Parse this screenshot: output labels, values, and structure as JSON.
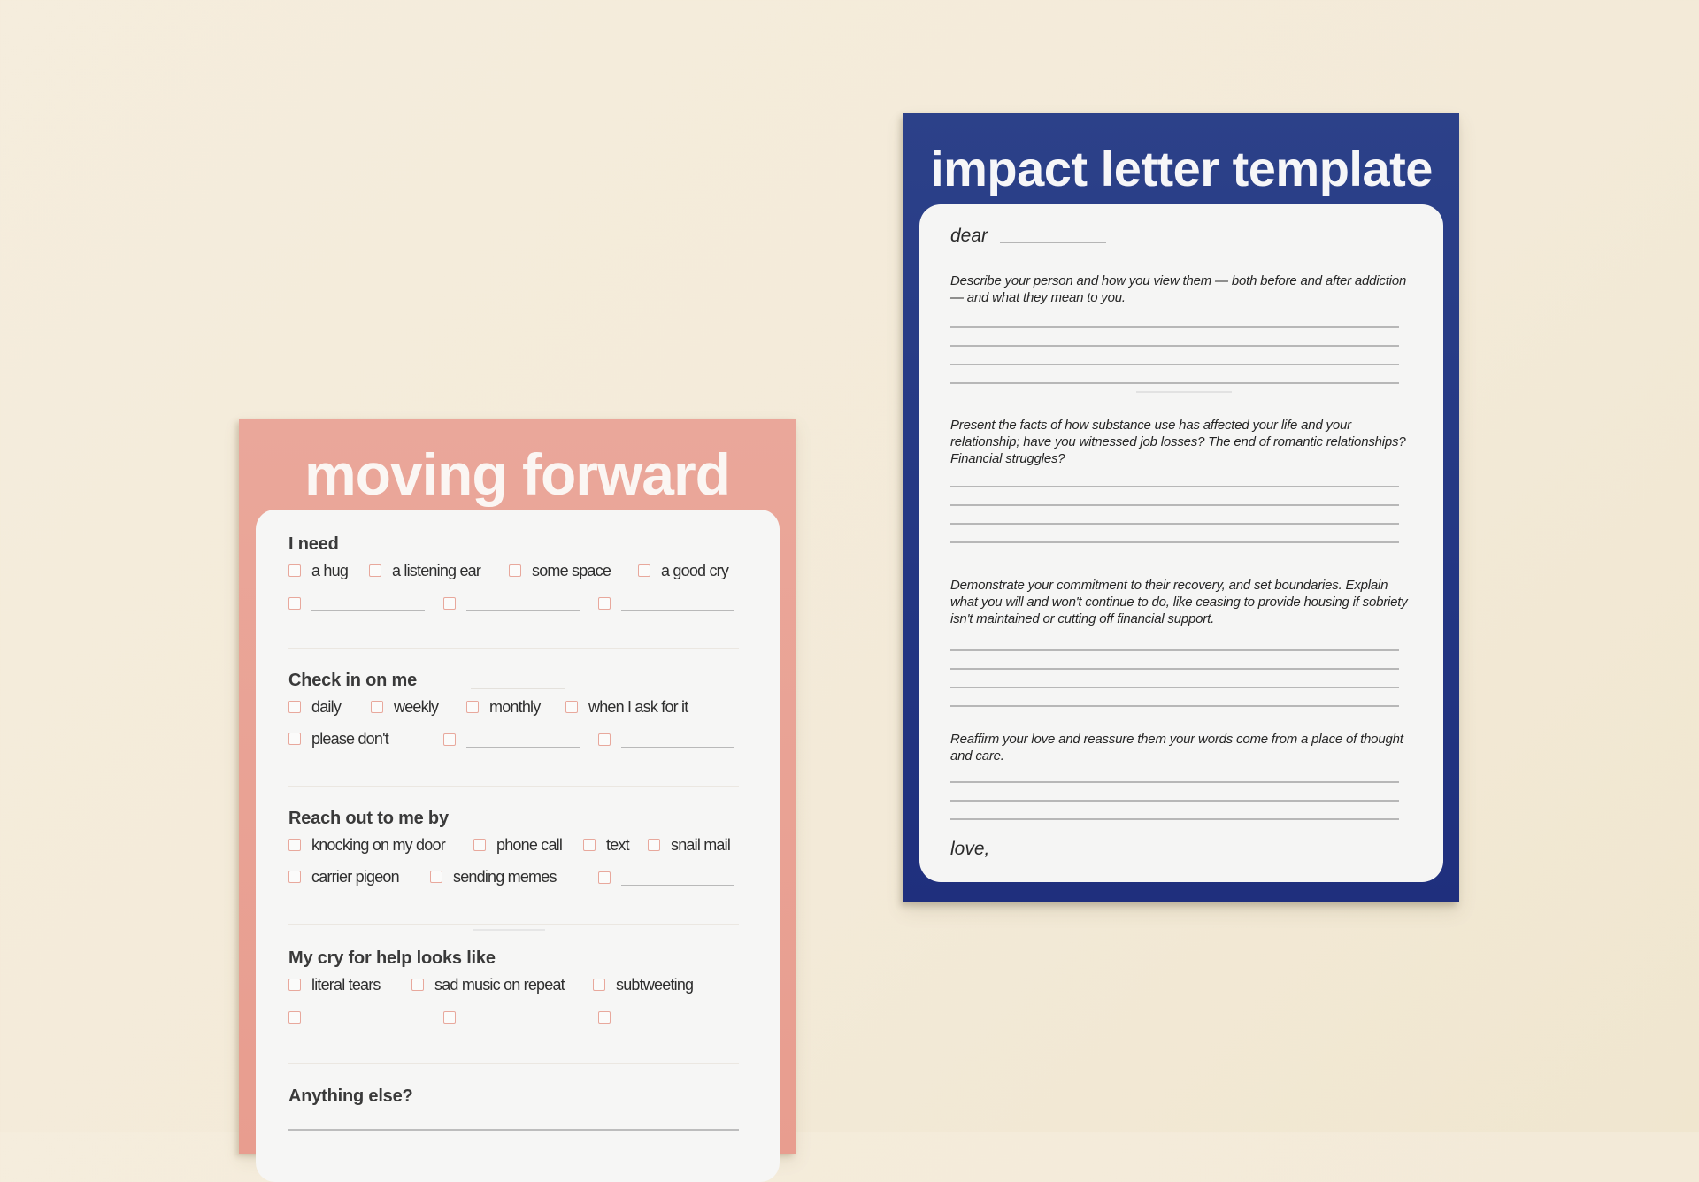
{
  "colors": {
    "background": "#f4ecdb",
    "pink_card": "#e9a295",
    "blue_card": "#243785",
    "panel": "#f6f6f5",
    "checkbox_border": "#e8a89c"
  },
  "moving_forward": {
    "title": "moving forward",
    "sections": [
      {
        "heading": "I need",
        "rows": [
          [
            "a hug",
            "a listening ear",
            "some space",
            "a good cry"
          ],
          [
            "",
            "",
            ""
          ]
        ]
      },
      {
        "heading": "Check in on me",
        "rows": [
          [
            "daily",
            "weekly",
            "monthly",
            "when I ask for it"
          ],
          [
            "please don't",
            "",
            ""
          ]
        ]
      },
      {
        "heading": "Reach out to me by",
        "rows": [
          [
            "knocking on my door",
            "phone call",
            "text",
            "snail mail"
          ],
          [
            "carrier pigeon",
            "sending memes",
            ""
          ]
        ]
      },
      {
        "heading": "My cry for help looks like",
        "rows": [
          [
            "literal tears",
            "sad music on repeat",
            "subtweeting"
          ],
          [
            "",
            "",
            ""
          ]
        ]
      },
      {
        "heading": "Anything else?",
        "rows": []
      }
    ]
  },
  "impact_letter": {
    "title": "impact letter template",
    "greeting": "dear",
    "prompts": [
      "Describe your person and how you view them — both before and after addiction — and what they mean to you.",
      "Present the facts of how substance use has affected your life and your relationship; have you witnessed job losses? The end of romantic relationships? Financial struggles?",
      "Demonstrate your commitment to their recovery, and set boundaries. Explain what you will and won't continue to do, like ceasing to provide housing if sobriety isn't maintained or cutting off financial support.",
      "Reaffirm your love and reassure them your words come from a place of thought and care."
    ],
    "closing": "love,"
  }
}
